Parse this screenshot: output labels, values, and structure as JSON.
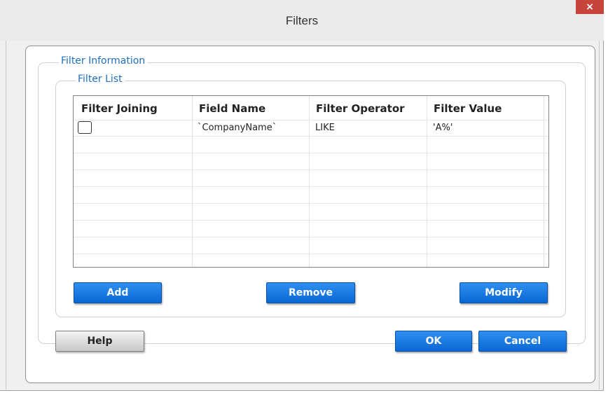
{
  "window": {
    "title": "Filters",
    "close_glyph": "×"
  },
  "groups": {
    "filter_information": "Filter Information",
    "filter_list": "Filter List"
  },
  "table": {
    "columns": [
      "Filter Joining",
      "Field Name",
      "Filter Operator",
      "Filter Value"
    ],
    "rows": [
      {
        "joining_checked": false,
        "field_name": "`CompanyName`",
        "operator": "LIKE",
        "value": "'A%'"
      }
    ]
  },
  "buttons": {
    "add": "Add",
    "remove": "Remove",
    "modify": "Modify",
    "help": "Help",
    "ok": "OK",
    "cancel": "Cancel"
  },
  "colors": {
    "accent_blue": "#0a67d4",
    "legend_blue": "#1f6fbf",
    "close_red": "#c7443a"
  }
}
